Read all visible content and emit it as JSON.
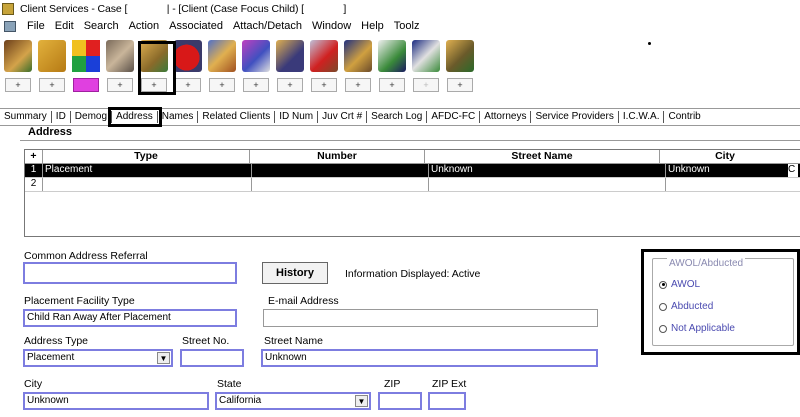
{
  "window": {
    "title": "Client Services - Case [              | - [Client (Case Focus Child) [              ]"
  },
  "menu": [
    "File",
    "Edit",
    "Search",
    "Action",
    "Associated",
    "Attach/Detach",
    "Window",
    "Help",
    "Toolz"
  ],
  "toolbar": {
    "icons": [
      "case-icon",
      "folder-icon",
      "color-icon",
      "photo-icon",
      "people-icon",
      "apple-icon",
      "transfer-icon",
      "edit-icon",
      "info-icon",
      "medical-icon",
      "binoculars-icon",
      "document-icon",
      "calc-icon",
      "person-icon"
    ],
    "plus_label": "+"
  },
  "tabs": [
    "Summary",
    "ID",
    "Demog",
    "Address",
    "Names",
    "Related Clients",
    "ID Num",
    "Juv Crt #",
    "Search Log",
    "AFDC-FC",
    "Attorneys",
    "Service Providers",
    "I.C.W.A.",
    "Contrib"
  ],
  "address": {
    "group_title": "Address",
    "columns": [
      "+",
      "Type",
      "Number",
      "Street Name",
      "City"
    ],
    "rows": [
      {
        "idx": "1",
        "type": "Placement",
        "number": "",
        "street": "Unknown",
        "city": "Unknown",
        "extra": "C"
      },
      {
        "idx": "2",
        "type": "",
        "number": "",
        "street": "",
        "city": "",
        "extra": ""
      }
    ]
  },
  "form": {
    "common_address_referral_label": "Common Address Referral",
    "common_address_referral_value": "",
    "history_button": "History",
    "info_displayed": "Information Displayed: Active",
    "placement_facility_type_label": "Placement Facility Type",
    "placement_facility_type_value": "Child Ran Away After Placement",
    "email_label": "E-mail Address",
    "email_value": "",
    "address_type_label": "Address Type",
    "address_type_value": "Placement",
    "street_no_label": "Street No.",
    "street_no_value": "",
    "street_name_label": "Street Name",
    "street_name_value": "Unknown",
    "city_label": "City",
    "city_value": "Unknown",
    "state_label": "State",
    "state_value": "California",
    "zip_label": "ZIP",
    "zip_value": "",
    "zip_ext_label": "ZIP Ext",
    "zip_ext_value": ""
  },
  "awol": {
    "legend": "AWOL/Abducted",
    "options": [
      "AWOL",
      "Abducted",
      "Not Applicable"
    ],
    "selected": "AWOL"
  }
}
